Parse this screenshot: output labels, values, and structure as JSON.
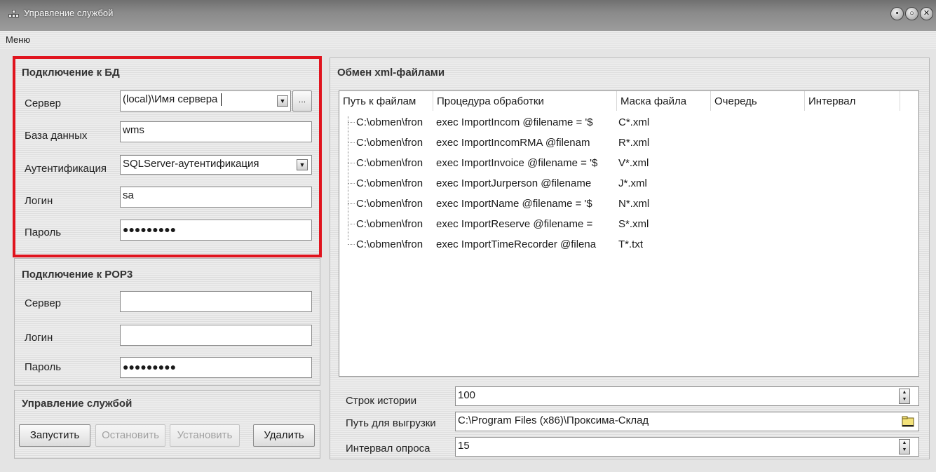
{
  "window": {
    "title": "Управление службой"
  },
  "menu": {
    "label": "Меню"
  },
  "db": {
    "title": "Подключение к БД",
    "server_label": "Сервер",
    "server_value": "(local)\\Имя сервера",
    "database_label": "База данных",
    "database_value": "wms",
    "auth_label": "Аутентификация",
    "auth_value": "SQLServer-аутентификация",
    "login_label": "Логин",
    "login_value": "sa",
    "password_label": "Пароль",
    "password_value": "●●●●●●●●●"
  },
  "pop3": {
    "title": "Подключение к POP3",
    "server_label": "Сервер",
    "server_value": "",
    "login_label": "Логин",
    "login_value": "",
    "password_label": "Пароль",
    "password_value": "●●●●●●●●●"
  },
  "service": {
    "title": "Управление службой",
    "start": "Запустить",
    "stop": "Остановить",
    "install": "Установить",
    "delete": "Удалить"
  },
  "xml": {
    "title": "Обмен xml-файлами",
    "columns": [
      "Путь к файлам",
      "Процедура обработки",
      "Маска файла",
      "Очередь",
      "Интервал"
    ],
    "rows": [
      {
        "path": "C:\\obmen\\fron",
        "proc": "exec ImportIncom @filename = '$",
        "mask": "C*.xml"
      },
      {
        "path": "C:\\obmen\\fron",
        "proc": "exec ImportIncomRMA @filenam",
        "mask": "R*.xml"
      },
      {
        "path": "C:\\obmen\\fron",
        "proc": "exec ImportInvoice @filename = '$",
        "mask": "V*.xml"
      },
      {
        "path": "C:\\obmen\\fron",
        "proc": "exec ImportJurperson @filename",
        "mask": "J*.xml"
      },
      {
        "path": "C:\\obmen\\fron",
        "proc": "exec ImportName @filename = '$",
        "mask": "N*.xml"
      },
      {
        "path": "C:\\obmen\\fron",
        "proc": "exec ImportReserve @filename =",
        "mask": "S*.xml"
      },
      {
        "path": "C:\\obmen\\fron",
        "proc": "exec ImportTimeRecorder @filena",
        "mask": "T*.txt"
      }
    ]
  },
  "settings": {
    "history_label": "Строк истории",
    "history_value": "100",
    "export_label": "Путь для выгрузки",
    "export_value": "C:\\Program Files (x86)\\Проксима-Склад",
    "poll_label": "Интервал опроса",
    "poll_value": "15"
  },
  "icons": [
    "app-icon",
    "minimize-icon",
    "maximize-icon",
    "close-icon",
    "dropdown-arrow-icon",
    "browse-icon",
    "spin-up-icon",
    "spin-down-icon",
    "folder-icon"
  ]
}
